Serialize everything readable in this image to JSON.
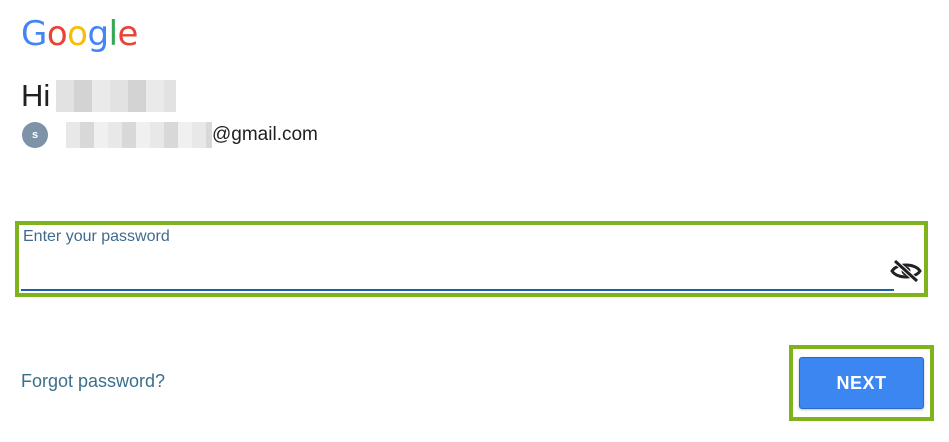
{
  "logo": {
    "letters": [
      "G",
      "o",
      "o",
      "g",
      "l",
      "e"
    ],
    "colors": [
      "#4285f4",
      "#ea4335",
      "#fbbc05",
      "#4285f4",
      "#34a853",
      "#ea4335"
    ]
  },
  "greeting": {
    "prefix": "Hi"
  },
  "account": {
    "avatar_initial": "s",
    "email_domain": "@gmail.com"
  },
  "password": {
    "label": "Enter your password",
    "value": "",
    "toggle_icon": "eye-off-icon"
  },
  "links": {
    "forgot_password": "Forgot password?"
  },
  "actions": {
    "next_label": "NEXT"
  },
  "colors": {
    "highlight_border": "#7fb31c",
    "primary_button": "#3b86f0",
    "link": "#3b6f8e",
    "input_underline": "#1a5fa8"
  }
}
